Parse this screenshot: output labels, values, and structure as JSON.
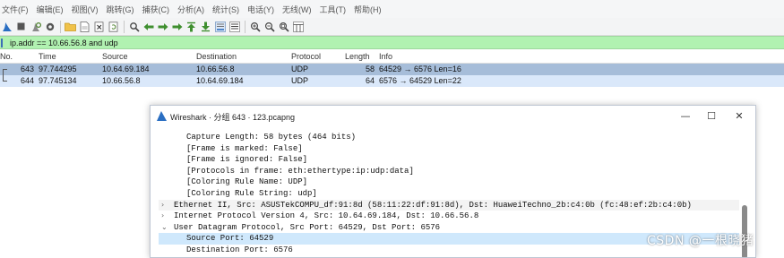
{
  "menu": [
    "文件(F)",
    "编辑(E)",
    "视图(V)",
    "跳转(G)",
    "捕获(C)",
    "分析(A)",
    "统计(S)",
    "电话(Y)",
    "无线(W)",
    "工具(T)",
    "帮助(H)"
  ],
  "toolbar": {
    "icons": [
      "shark-fin-start-icon",
      "stop-square-icon",
      "restart-capture-icon",
      "options-gear-icon",
      "open-folder-icon",
      "file-save-icon",
      "close-file-icon",
      "reload-icon",
      "find-packet-icon",
      "go-back-icon",
      "go-forward-icon",
      "go-to-packet-icon",
      "go-first-icon",
      "go-last-icon",
      "autoscroll-icon",
      "colorize-icon",
      "zoom-in-icon",
      "zoom-out-icon",
      "normal-size-icon",
      "resize-columns-icon"
    ]
  },
  "filter": {
    "value": "ip.addr == 10.66.56.8 and udp",
    "accent": "#b1f2b1"
  },
  "packet_list": {
    "columns": [
      "No.",
      "Time",
      "Source",
      "Destination",
      "Protocol",
      "Length",
      "Info"
    ],
    "rows": [
      {
        "no": "643",
        "time": "97.744295",
        "source": "10.64.69.184",
        "destination": "10.66.56.8",
        "protocol": "UDP",
        "length": "58",
        "info": "64529 → 6576 Len=16",
        "color": "#a6bdd9"
      },
      {
        "no": "644",
        "time": "97.745134",
        "source": "10.66.56.8",
        "destination": "10.64.69.184",
        "protocol": "UDP",
        "length": "64",
        "info": "6576 → 64529 Len=22",
        "color": "#dae8fa"
      }
    ]
  },
  "dialog": {
    "title": "Wireshark · 分组 643 · 123.pcapng",
    "buttons": {
      "minimize": "—",
      "maximize": "☐",
      "close": "✕"
    },
    "tree": [
      {
        "text": "Capture Length: 58 bytes (464 bits)",
        "arrow": "",
        "style": "child"
      },
      {
        "text": "[Frame is marked: False]",
        "arrow": "",
        "style": "child"
      },
      {
        "text": "[Frame is ignored: False]",
        "arrow": "",
        "style": "child"
      },
      {
        "text": "[Protocols in frame: eth:ethertype:ip:udp:data]",
        "arrow": "",
        "style": "child"
      },
      {
        "text": "[Coloring Rule Name: UDP]",
        "arrow": "",
        "style": "child"
      },
      {
        "text": "[Coloring Rule String: udp]",
        "arrow": "",
        "style": "child"
      },
      {
        "text": "Ethernet II, Src: ASUSTekCOMPU_df:91:8d (58:11:22:df:91:8d), Dst: HuaweiTechno_2b:c4:0b (fc:48:ef:2b:c4:0b)",
        "arrow": "›",
        "style": "top"
      },
      {
        "text": "Internet Protocol Version 4, Src: 10.64.69.184, Dst: 10.66.56.8",
        "arrow": "›",
        "style": "plain"
      },
      {
        "text": "User Datagram Protocol, Src Port: 64529, Dst Port: 6576",
        "arrow": "⌄",
        "style": "plain"
      },
      {
        "text": "Source Port: 64529",
        "arrow": "",
        "style": "sel"
      },
      {
        "text": "Destination Port: 6576",
        "arrow": "",
        "style": "child"
      }
    ]
  },
  "watermark": "CSDN @一根晓猪"
}
